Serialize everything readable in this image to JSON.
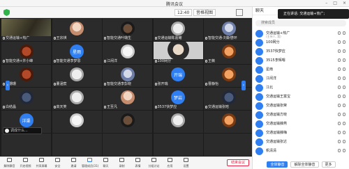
{
  "window": {
    "title": "腾讯会议"
  },
  "topbar": {
    "clock": "12:40",
    "view_label": "音格视图"
  },
  "speaking": {
    "text": "正在讲话: 交通运输+热广;"
  },
  "panel": {
    "title": "聊天",
    "search_placeholder": "搜索成员",
    "members": [
      {
        "name": "交通运输+热广",
        "sub": "(主持人, 我)"
      },
      {
        "name": "100网分",
        "sub": ""
      },
      {
        "name": "3537快梦应",
        "sub": ""
      },
      {
        "name": "3515李辉嗯",
        "sub": ""
      },
      {
        "name": "星雨",
        "sub": ""
      },
      {
        "name": "江闲洋",
        "sub": ""
      },
      {
        "name": "江北",
        "sub": ""
      },
      {
        "name": "交通运输王富宝",
        "sub": ""
      },
      {
        "name": "交通运输张荣",
        "sub": ""
      },
      {
        "name": "交通运输方晓",
        "sub": ""
      },
      {
        "name": "交通运输薛燕",
        "sub": ""
      },
      {
        "name": "交通运输薛梅",
        "sub": ""
      },
      {
        "name": "交通运输张达",
        "sub": ""
      },
      {
        "name": "帆清清",
        "sub": ""
      }
    ],
    "buttons": {
      "mute_all": "全体静音",
      "unmute_all": "解除全体静音",
      "more": "更多"
    }
  },
  "tiles": [
    {
      "label": "交通运输+热广",
      "kind": "video",
      "variant": "v1"
    },
    {
      "label": "王宗祺",
      "kind": "avatar",
      "variant": "img1",
      "text": ""
    },
    {
      "label": "智能交通叶璐生",
      "kind": "avatar",
      "variant": "img2",
      "text": ""
    },
    {
      "label": "交通运输陈嘉耀",
      "kind": "avatar",
      "variant": "img3",
      "text": ""
    },
    {
      "label": "智能交通-刘斯懋环",
      "kind": "avatar",
      "variant": "img4",
      "text": ""
    },
    {
      "label": "智能交通+井小峰",
      "kind": "avatar",
      "variant": "img5",
      "text": ""
    },
    {
      "label": "智能交通李梦思",
      "kind": "avatar",
      "variant": "text",
      "text": "星雨"
    },
    {
      "label": "江闲洋",
      "kind": "avatar",
      "variant": "img6",
      "text": ""
    },
    {
      "label": "100网分",
      "kind": "video",
      "variant": "v2"
    },
    {
      "label": "王薇",
      "kind": "avatar",
      "variant": "img7",
      "text": ""
    },
    {
      "label": "周珊珊",
      "kind": "avatar",
      "variant": "img5",
      "text": ""
    },
    {
      "label": "董涵宸",
      "kind": "avatar",
      "variant": "img3",
      "text": ""
    },
    {
      "label": "智能交通李彭晓",
      "kind": "avatar",
      "variant": "img4",
      "text": ""
    },
    {
      "label": "张开瑞",
      "kind": "avatar",
      "variant": "text",
      "text": "开瑞"
    },
    {
      "label": "曹静怡",
      "kind": "avatar",
      "variant": "img7",
      "text": ""
    },
    {
      "label": "白结晶",
      "kind": "avatar",
      "variant": "img8",
      "text": ""
    },
    {
      "label": "高天笑",
      "kind": "avatar",
      "variant": "img3",
      "text": ""
    },
    {
      "label": "王至凡",
      "kind": "avatar",
      "variant": "img1",
      "text": ""
    },
    {
      "label": "3537快梦应",
      "kind": "avatar",
      "variant": "text",
      "text": "梦岩"
    },
    {
      "label": "交通运输张晗",
      "kind": "avatar",
      "variant": "img8",
      "text": ""
    },
    {
      "label": "",
      "kind": "avatar",
      "variant": "text",
      "text": "洋渠"
    },
    {
      "label": "",
      "kind": "avatar",
      "variant": "img6",
      "text": ""
    },
    {
      "label": "",
      "kind": "avatar",
      "variant": "img2",
      "text": ""
    },
    {
      "label": "",
      "kind": "avatar",
      "variant": "img3",
      "text": ""
    },
    {
      "label": "",
      "kind": "avatar",
      "variant": "img7",
      "text": ""
    },
    {
      "label": "",
      "kind": "blank",
      "variant": "",
      "text": ""
    },
    {
      "label": "",
      "kind": "blank",
      "variant": "",
      "text": ""
    },
    {
      "label": "",
      "kind": "blank",
      "variant": "",
      "text": ""
    },
    {
      "label": "",
      "kind": "blank",
      "variant": "",
      "text": ""
    },
    {
      "label": "",
      "kind": "blank",
      "variant": "",
      "text": ""
    }
  ],
  "popup": {
    "text": "调成什么..."
  },
  "toolbar": {
    "items": [
      {
        "label": "解除静音",
        "icon": "mic-icon"
      },
      {
        "label": "开启视频",
        "icon": "camera-icon"
      },
      {
        "label": "共享屏幕",
        "icon": "share-screen-icon"
      },
      {
        "label": "安全",
        "icon": "shield-icon"
      },
      {
        "label": "邀请",
        "icon": "invite-icon"
      },
      {
        "label": "管理成员(31)",
        "icon": "members-icon"
      },
      {
        "label": "聊天",
        "icon": "chat-icon"
      },
      {
        "label": "录制",
        "icon": "record-icon"
      },
      {
        "label": "表情",
        "icon": "emoji-icon"
      },
      {
        "label": "分组讨论",
        "icon": "breakout-icon"
      },
      {
        "label": "应用",
        "icon": "apps-icon"
      },
      {
        "label": "设置",
        "icon": "settings-icon"
      }
    ],
    "end_label": "结束会议"
  }
}
